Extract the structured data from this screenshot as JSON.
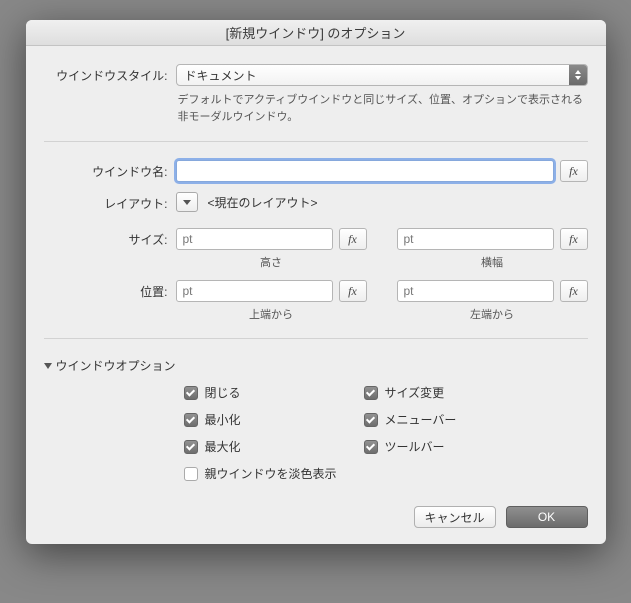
{
  "title": "[新規ウインドウ] のオプション",
  "style": {
    "label": "ウインドウスタイル:",
    "value": "ドキュメント",
    "help": "デフォルトでアクティブウインドウと同じサイズ、位置、オプションで表示される非モーダルウインドウ。"
  },
  "name": {
    "label": "ウインドウ名:",
    "value": ""
  },
  "layout": {
    "label": "レイアウト:",
    "value": "<現在のレイアウト>"
  },
  "size": {
    "label": "サイズ:",
    "height": {
      "placeholder": "pt",
      "sublabel": "高さ"
    },
    "width": {
      "placeholder": "pt",
      "sublabel": "横幅"
    }
  },
  "position": {
    "label": "位置:",
    "top": {
      "placeholder": "pt",
      "sublabel": "上端から"
    },
    "left": {
      "placeholder": "pt",
      "sublabel": "左端から"
    }
  },
  "options": {
    "title": "ウインドウオプション",
    "close": "閉じる",
    "resize": "サイズ変更",
    "minimize": "最小化",
    "menubar": "メニューバー",
    "maximize": "最大化",
    "toolbar": "ツールバー",
    "dim_parent": "親ウインドウを淡色表示"
  },
  "buttons": {
    "cancel": "キャンセル",
    "ok": "OK"
  },
  "fx_label": "fx"
}
